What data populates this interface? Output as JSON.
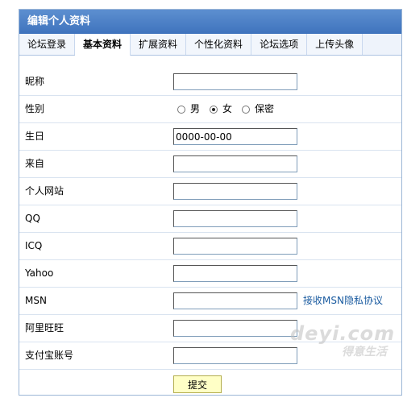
{
  "panel": {
    "title": "编辑个人资料"
  },
  "tabs": [
    {
      "label": "论坛登录",
      "active": false
    },
    {
      "label": "基本资料",
      "active": true
    },
    {
      "label": "扩展资料",
      "active": false
    },
    {
      "label": "个性化资料",
      "active": false
    },
    {
      "label": "论坛选项",
      "active": false
    },
    {
      "label": "上传头像",
      "active": false
    }
  ],
  "form": {
    "nickname": {
      "label": "昵称",
      "value": ""
    },
    "gender": {
      "label": "性别",
      "options": [
        {
          "label": "男",
          "checked": false
        },
        {
          "label": "女",
          "checked": true
        },
        {
          "label": "保密",
          "checked": false
        }
      ]
    },
    "birthday": {
      "label": "生日",
      "value": "0000-00-00"
    },
    "from": {
      "label": "来自",
      "value": ""
    },
    "website": {
      "label": "个人网站",
      "value": ""
    },
    "qq": {
      "label": "QQ",
      "value": ""
    },
    "icq": {
      "label": "ICQ",
      "value": ""
    },
    "yahoo": {
      "label": "Yahoo",
      "value": ""
    },
    "msn": {
      "label": "MSN",
      "value": "",
      "link": "接收MSN隐私协议"
    },
    "aliwangwang": {
      "label": "阿里旺旺",
      "value": ""
    },
    "alipay": {
      "label": "支付宝账号",
      "value": ""
    },
    "submit_label": "提交"
  },
  "watermark": {
    "line1": "deyi.com",
    "line2": "得意生活"
  },
  "colors": {
    "title_bar": "#4a7ec4",
    "link": "#1a5ba0",
    "submit_bg": "#ffffc6"
  }
}
